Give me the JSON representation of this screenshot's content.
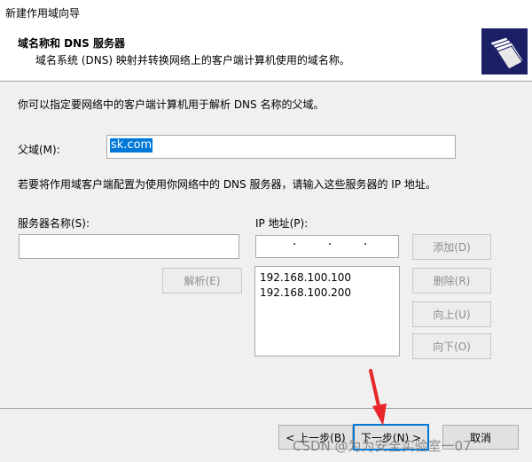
{
  "window": {
    "title": "新建作用域向导"
  },
  "header": {
    "title": "域名称和 DNS 服务器",
    "subtitle": "域名系统 (DNS) 映射并转换网络上的客户端计算机使用的域名称。",
    "icon": "folders-icon"
  },
  "body": {
    "intro": "你可以指定要网络中的客户端计算机用于解析 DNS 名称的父域。",
    "parent_domain_label": "父域(M):",
    "parent_domain_value": "sk.com",
    "dns_hint": "若要将作用域客户端配置为使用你网络中的 DNS 服务器，请输入这些服务器的 IP 地址。",
    "server_name_label": "服务器名称(S):",
    "server_name_value": "",
    "ip_label": "IP 地址(P):",
    "resolve_button": "解析(E)",
    "add_button": "添加(D)",
    "remove_button": "删除(R)",
    "up_button": "向上(U)",
    "down_button": "向下(O)",
    "ip_list": [
      "192.168.100.100",
      "192.168.100.200"
    ]
  },
  "footer": {
    "back_button": "< 上一步(B)",
    "next_button": "下一步(N) >",
    "cancel_button": "取消"
  },
  "watermark": "CSDN @为为安全实验室一07",
  "colors": {
    "header_icon_bg": "#1a1f66",
    "selection": "#0078d7",
    "arrow": "#e8262b"
  }
}
